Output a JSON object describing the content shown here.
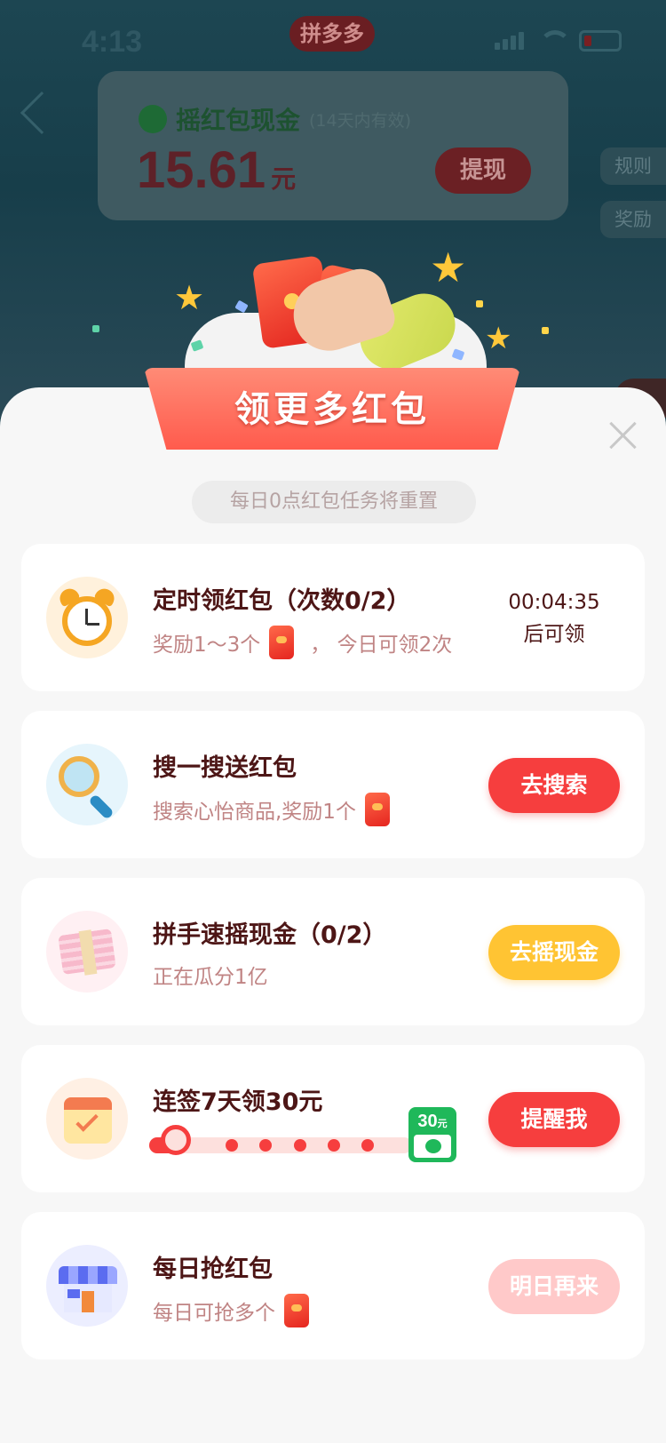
{
  "status_bar": {
    "time": "4:13",
    "app_name": "拼多多"
  },
  "cash_card": {
    "title": "摇红包现金",
    "validity_note": "(14天内有效)",
    "amount": "15.61",
    "unit": "元",
    "withdraw_label": "提现"
  },
  "side_buttons": {
    "rules": "规则",
    "rewards": "奖励"
  },
  "modal": {
    "banner_title": "领更多红包",
    "reset_note": "每日0点红包任务将重置"
  },
  "tasks": [
    {
      "title": "定时领红包（次数0/2）",
      "sub_prefix": "奖励1～3个",
      "sub_suffix": "，  今日可领2次",
      "countdown": "00:04:35",
      "countdown_note": "后可领",
      "icon": "alarm-clock-icon"
    },
    {
      "title": "搜一搜送红包",
      "sub_prefix": "搜索心怡商品,奖励1个",
      "button": "去搜索",
      "icon": "magnifier-icon"
    },
    {
      "title": "拼手速摇现金（0/2）",
      "sub_prefix": "正在瓜分1亿",
      "button": "去摇现金",
      "icon": "cash-stack-icon"
    },
    {
      "title": "连签7天领30元",
      "reward_amount": "30",
      "reward_unit": "元",
      "days_signed": 1,
      "days_total": 7,
      "button": "提醒我",
      "icon": "calendar-icon"
    },
    {
      "title": "每日抢红包",
      "sub_prefix": "每日可抢多个",
      "button": "明日再来",
      "icon": "shop-icon"
    }
  ],
  "colors": {
    "primary_red": "#f63e3e",
    "accent_yellow": "#ffc433",
    "title_text": "#4d1616",
    "sub_text": "#c08484",
    "wechat_green": "#1fb85a"
  }
}
